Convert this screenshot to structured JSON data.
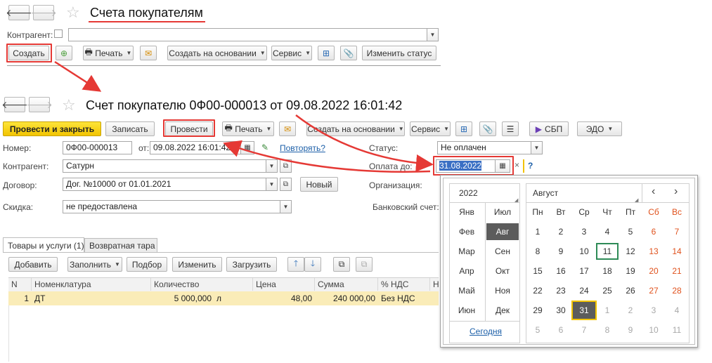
{
  "list_window": {
    "title": "Счета покупателям",
    "counterparty_label": "Контрагент:",
    "toolbar": {
      "create": "Создать",
      "print": "Печать",
      "create_based": "Создать на основании",
      "service": "Сервис",
      "change_status": "Изменить статус"
    }
  },
  "doc_window": {
    "title": "Счет покупателю 0Ф00-000013 от 09.08.2022 16:01:42",
    "toolbar": {
      "post_close": "Провести и закрыть",
      "save": "Записать",
      "post": "Провести",
      "print": "Печать",
      "create_based": "Создать на основании",
      "service": "Сервис",
      "sbp": "СБП",
      "edo": "ЭДО"
    },
    "fields": {
      "number_label": "Номер:",
      "number": "0Ф00-000013",
      "from_label": "от:",
      "date": "09.08.2022 16:01:42",
      "repeat_link": "Повторять?",
      "status_label": "Статус:",
      "status": "Не оплачен",
      "counterparty_label": "Контрагент:",
      "counterparty": "Сатурн",
      "payment_due_label": "Оплата до:",
      "payment_due": "31.08.2022",
      "clear": "×",
      "help": "?",
      "contract_label": "Договор:",
      "contract": "Дог. №10000 от 01.01.2021",
      "new_button": "Новый",
      "org_label": "Организация:",
      "discount_label": "Скидка:",
      "discount": "не предоставлена",
      "bank_label": "Банковский счет:"
    },
    "tabs": [
      "Товары и услуги (1)",
      "Возвратная тара"
    ],
    "table_toolbar": {
      "add": "Добавить",
      "fill": "Заполнить",
      "pick": "Подбор",
      "change": "Изменить",
      "load": "Загрузить"
    },
    "table": {
      "headers": [
        "N",
        "Номенклатура",
        "Количество",
        "Цена",
        "Сумма",
        "% НДС",
        "Н"
      ],
      "rows": [
        {
          "n": "1",
          "item": "ДТ",
          "qty": "5 000,000",
          "unit": "л",
          "price": "48,00",
          "sum": "240 000,00",
          "vat": "Без НДС"
        }
      ]
    }
  },
  "calendar": {
    "year": "2022",
    "months": [
      "Янв",
      "Июл",
      "Фев",
      "Авг",
      "Мар",
      "Сен",
      "Апр",
      "Окт",
      "Май",
      "Ноя",
      "Июн",
      "Дек"
    ],
    "selected_month": "Авг",
    "month_title": "Август",
    "weekdays": [
      "Пн",
      "Вт",
      "Ср",
      "Чт",
      "Пт",
      "Сб",
      "Вс"
    ],
    "days": [
      [
        "1",
        "2",
        "3",
        "4",
        "5",
        "6",
        "7"
      ],
      [
        "8",
        "9",
        "10",
        "11",
        "12",
        "13",
        "14"
      ],
      [
        "15",
        "16",
        "17",
        "18",
        "19",
        "20",
        "21"
      ],
      [
        "22",
        "23",
        "24",
        "25",
        "26",
        "27",
        "28"
      ],
      [
        "29",
        "30",
        "31",
        "1",
        "2",
        "3",
        "4"
      ],
      [
        "5",
        "6",
        "7",
        "8",
        "9",
        "10",
        "11"
      ]
    ],
    "today_label": "Сегодня",
    "prev": "‹",
    "next": "›"
  },
  "colors": {
    "accent_red": "#e53935",
    "yellow_button": "#f5cc13",
    "weekend": "#e0521d",
    "selected_dark": "#5c5c5c"
  }
}
